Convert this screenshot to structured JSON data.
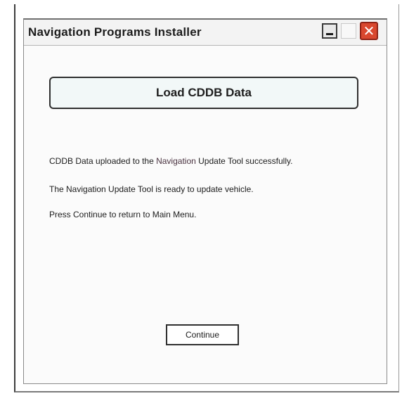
{
  "window": {
    "title": "Navigation Programs Installer",
    "controls": {
      "minimize": "minimize-icon",
      "maximize": "maximize-icon",
      "close": "close-icon",
      "close_color": "#d9482f"
    }
  },
  "dialog": {
    "heading": "Load CDDB Data",
    "messages": {
      "line1": {
        "before": "CDDB Data uploaded to the ",
        "highlight": "Navigation",
        "after": " Update Tool successfully."
      },
      "line2": "The Navigation Update Tool is ready to update vehicle.",
      "line3": "Press Continue to return to Main Menu."
    },
    "continue_label": "Continue"
  }
}
